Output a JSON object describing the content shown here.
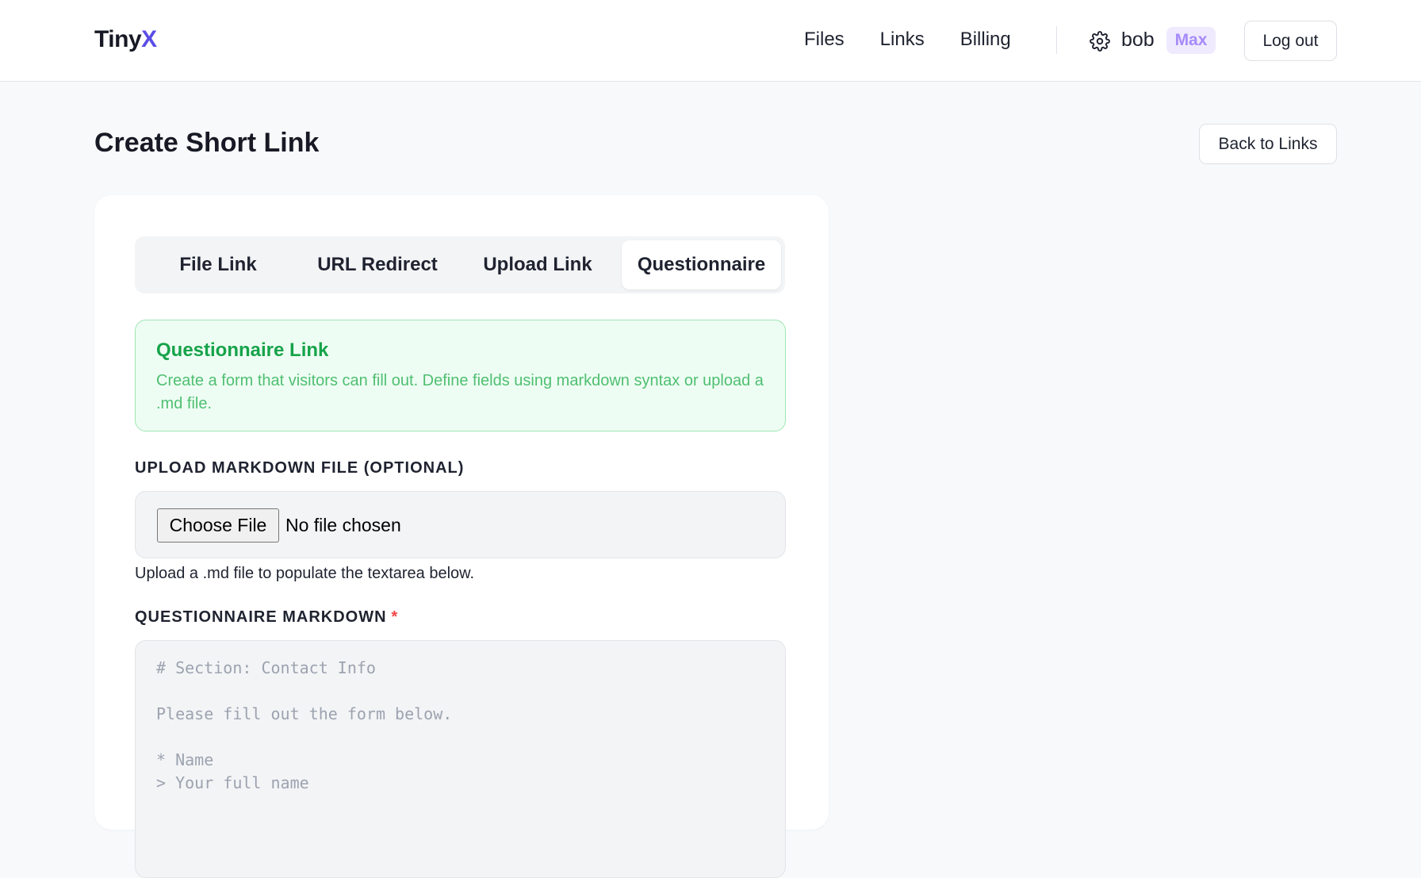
{
  "header": {
    "logo_main": "Tiny",
    "logo_accent": "X",
    "nav": [
      {
        "label": "Files"
      },
      {
        "label": "Links"
      },
      {
        "label": "Billing"
      }
    ],
    "settings_icon": "gear-icon",
    "username": "bob",
    "plan_badge": "Max",
    "logout_label": "Log out"
  },
  "page": {
    "title": "Create Short Link",
    "back_label": "Back to Links"
  },
  "tabs": [
    {
      "label": "File Link",
      "active": false
    },
    {
      "label": "URL Redirect",
      "active": false
    },
    {
      "label": "Upload Link",
      "active": false
    },
    {
      "label": "Questionnaire",
      "active": true
    }
  ],
  "info": {
    "title": "Questionnaire Link",
    "description": "Create a form that visitors can fill out. Define fields using markdown syntax or upload a .md file."
  },
  "upload": {
    "label": "UPLOAD MARKDOWN FILE (OPTIONAL)",
    "button_label": "Choose File",
    "status": "No file chosen",
    "helper": "Upload a .md file to populate the textarea below."
  },
  "markdown": {
    "label": "QUESTIONNAIRE MARKDOWN",
    "required_mark": "*",
    "placeholder": "# Section: Contact Info\n\nPlease fill out the form below.\n\n* Name\n> Your full name"
  },
  "colors": {
    "accent": "#5b4de6",
    "info_green": "#16a34a",
    "badge_purple": "#a78bfa",
    "required_red": "#ef4444"
  }
}
